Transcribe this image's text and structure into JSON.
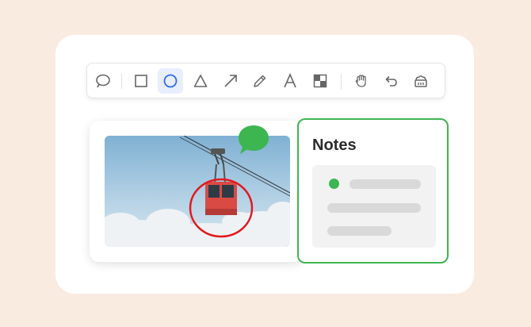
{
  "notes": {
    "title": "Notes"
  },
  "colors": {
    "background": "#faebe1",
    "accent_green": "#3db551",
    "active_tool": "#2f6bf5",
    "annotation_red": "#e0191e"
  },
  "toolbar": {
    "tools": [
      "lasso-icon",
      "rectangle-icon",
      "ellipse-icon",
      "triangle-icon",
      "arrow-icon",
      "pencil-icon",
      "text-icon",
      "mosaic-icon",
      "hand-icon",
      "undo-icon",
      "eraser-icon"
    ],
    "active": "ellipse-icon"
  }
}
